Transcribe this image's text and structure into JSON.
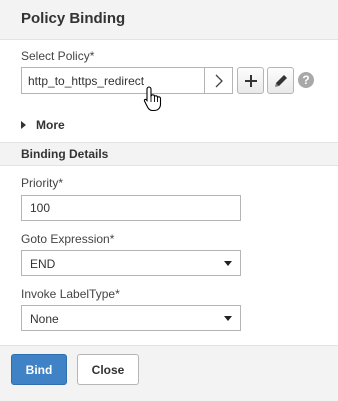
{
  "header": {
    "title": "Policy Binding"
  },
  "select_policy": {
    "label": "Select Policy*",
    "value": "http_to_https_redirect"
  },
  "more": {
    "label": "More"
  },
  "binding_details": {
    "title": "Binding Details"
  },
  "priority": {
    "label": "Priority*",
    "value": "100"
  },
  "goto_expression": {
    "label": "Goto Expression*",
    "value": "END"
  },
  "invoke_labeltype": {
    "label": "Invoke LabelType*",
    "value": "None"
  },
  "footer": {
    "bind_label": "Bind",
    "close_label": "Close"
  },
  "icons": {
    "help": "?"
  }
}
